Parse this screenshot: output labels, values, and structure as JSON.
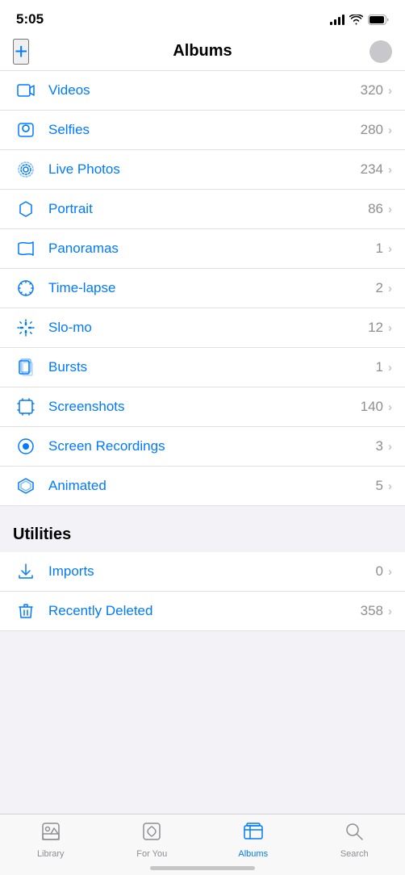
{
  "statusBar": {
    "time": "5:05"
  },
  "header": {
    "addLabel": "+",
    "title": "Albums"
  },
  "albumItems": [
    {
      "id": "videos",
      "label": "Videos",
      "count": 320,
      "iconType": "video"
    },
    {
      "id": "selfies",
      "label": "Selfies",
      "count": 280,
      "iconType": "selfie"
    },
    {
      "id": "live-photos",
      "label": "Live Photos",
      "count": 234,
      "iconType": "live"
    },
    {
      "id": "portrait",
      "label": "Portrait",
      "count": 86,
      "iconType": "portrait"
    },
    {
      "id": "panoramas",
      "label": "Panoramas",
      "count": 1,
      "iconType": "panorama"
    },
    {
      "id": "time-lapse",
      "label": "Time-lapse",
      "count": 2,
      "iconType": "timelapse"
    },
    {
      "id": "slo-mo",
      "label": "Slo-mo",
      "count": 12,
      "iconType": "slomo"
    },
    {
      "id": "bursts",
      "label": "Bursts",
      "count": 1,
      "iconType": "bursts"
    },
    {
      "id": "screenshots",
      "label": "Screenshots",
      "count": 140,
      "iconType": "screenshot"
    },
    {
      "id": "screen-recordings",
      "label": "Screen Recordings",
      "count": 3,
      "iconType": "screenrecord"
    },
    {
      "id": "animated",
      "label": "Animated",
      "count": 5,
      "iconType": "animated"
    }
  ],
  "utilities": {
    "sectionTitle": "Utilities",
    "items": [
      {
        "id": "imports",
        "label": "Imports",
        "count": 0,
        "iconType": "import"
      },
      {
        "id": "recently-deleted",
        "label": "Recently Deleted",
        "count": 358,
        "iconType": "trash"
      }
    ]
  },
  "tabBar": {
    "tabs": [
      {
        "id": "library",
        "label": "Library",
        "active": false
      },
      {
        "id": "for-you",
        "label": "For You",
        "active": false
      },
      {
        "id": "albums",
        "label": "Albums",
        "active": true
      },
      {
        "id": "search",
        "label": "Search",
        "active": false
      }
    ]
  }
}
